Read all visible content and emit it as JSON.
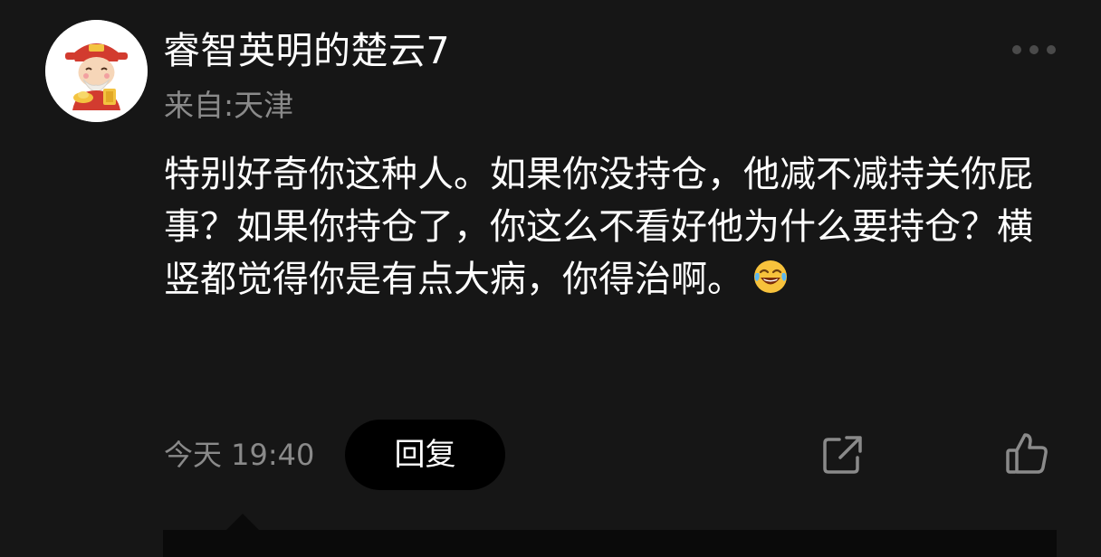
{
  "comment": {
    "username": "睿智英明的楚云7",
    "location": "来自:天津",
    "text": "特别好奇你这种人。如果你没持仓，他减不减持关你屁事？如果你持仓了，你这么不看好他为什么要持仓？横竖都觉得你是有点大病，你得治啊。",
    "emoji": "tears-of-joy-emoji",
    "timestamp": "今天 19:40"
  },
  "actions": {
    "reply_label": "回复",
    "share_icon": "share-icon",
    "like_icon": "thumbs-up-icon",
    "more_icon": "more-dots-icon"
  },
  "colors": {
    "background": "#161616",
    "primary_text": "#ffffff",
    "secondary_text": "#8a8a8a",
    "button_bg": "#000000",
    "icon": "#8a8a8a"
  }
}
